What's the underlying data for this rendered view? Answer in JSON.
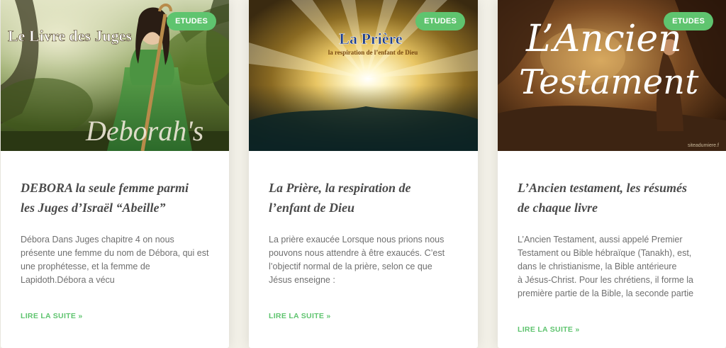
{
  "cards": [
    {
      "badge": "ETUDES",
      "image_text": "Le Livre des Juges",
      "image_caption": "Deborah's",
      "title_line1": "DEBORA la seule femme parmi",
      "title_line2": "les Juges d’Israël “Abeille”",
      "excerpt_lines": [
        "Débora Dans Juges chapitre 4 on nous",
        "présente une femme du nom de Débora, qui est",
        "une prophétesse, et la femme de",
        "Lapidoth.Débora a vécu"
      ],
      "read_more": "LIRE LA SUITE »"
    },
    {
      "badge": "ETUDES",
      "image_title": "La Prière",
      "image_subtitle": "la respiration de l’enfant de Dieu",
      "title_line1": "La Prière, la respiration de",
      "title_line2": "l’enfant de Dieu",
      "excerpt_lines": [
        "La prière exaucée Lorsque nous prions nous",
        "pouvons nous attendre à être exaucés. C’est",
        "l’objectif normal de la prière, selon ce que",
        "Jésus enseigne :"
      ],
      "read_more": "LIRE LA SUITE »"
    },
    {
      "badge": "ETUDES",
      "image_title_line1": "L’Ancien",
      "image_title_line2": "Testament",
      "image_watermark": "siteadumiere.f",
      "title_line1": "L’Ancien testament, les résumés",
      "title_line2": "de chaque livre",
      "excerpt_lines": [
        "L’Ancien Testament, aussi appelé Premier",
        "Testament ou Bible hébraïque (Tanakh), est,",
        "dans le christianisme, la Bible antérieure",
        "à Jésus-Christ. Pour les chrétiens, il forme la",
        "première partie de la Bible, la seconde partie"
      ],
      "read_more": "LIRE LA SUITE »"
    }
  ],
  "colors": {
    "accent": "#5fc46f",
    "title": "#4a4a4a",
    "text": "#6f6f6f",
    "background": "#f3f1e8"
  }
}
